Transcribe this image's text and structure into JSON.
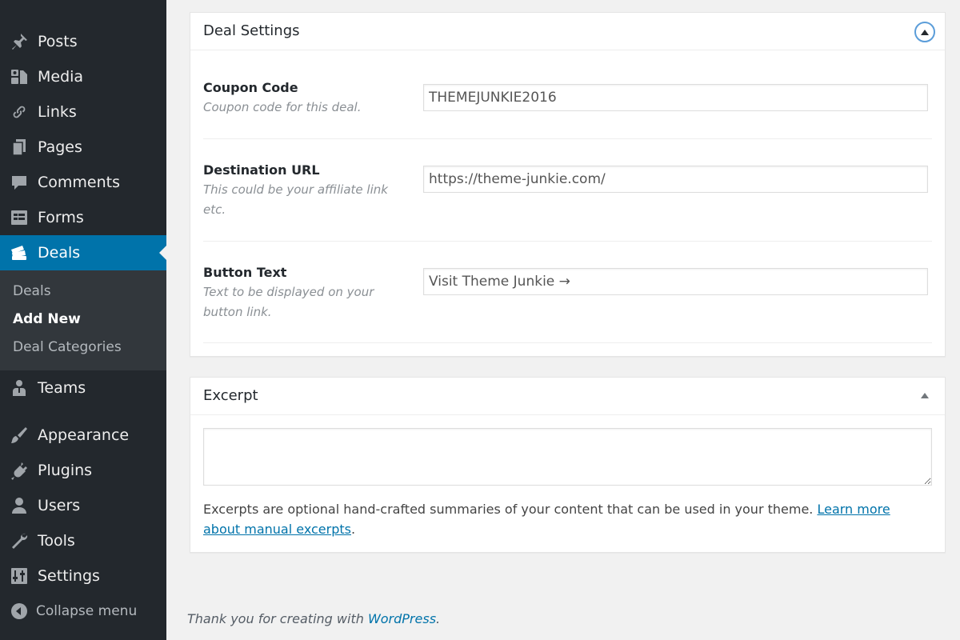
{
  "sidebar": {
    "items": [
      {
        "label": "Posts",
        "icon": "pin-icon"
      },
      {
        "label": "Media",
        "icon": "media-icon"
      },
      {
        "label": "Links",
        "icon": "link-icon"
      },
      {
        "label": "Pages",
        "icon": "pages-icon"
      },
      {
        "label": "Comments",
        "icon": "comment-icon"
      },
      {
        "label": "Forms",
        "icon": "forms-icon"
      },
      {
        "label": "Deals",
        "icon": "deals-icon",
        "current": true
      },
      {
        "label": "Teams",
        "icon": "teams-icon"
      },
      {
        "label": "Appearance",
        "icon": "brush-icon"
      },
      {
        "label": "Plugins",
        "icon": "plug-icon"
      },
      {
        "label": "Users",
        "icon": "user-icon"
      },
      {
        "label": "Tools",
        "icon": "wrench-icon"
      },
      {
        "label": "Settings",
        "icon": "settings-icon"
      }
    ],
    "submenu": [
      {
        "label": "Deals"
      },
      {
        "label": "Add New",
        "active": true
      },
      {
        "label": "Deal Categories"
      }
    ],
    "collapse_label": "Collapse menu",
    "accent_color": "#0073aa",
    "background_color": "#23282d"
  },
  "deal_settings": {
    "title": "Deal Settings",
    "fields": [
      {
        "label": "Coupon Code",
        "description": "Coupon code for this deal.",
        "value": "THEMEJUNKIE2016"
      },
      {
        "label": "Destination URL",
        "description": "This could be your affiliate link etc.",
        "value": "https://theme-junkie.com/"
      },
      {
        "label": "Button Text",
        "description": "Text to be displayed on your button link.",
        "value": "Visit Theme Junkie →"
      }
    ]
  },
  "excerpt": {
    "title": "Excerpt",
    "value": "",
    "help_text": "Excerpts are optional hand-crafted summaries of your content that can be used in your theme. ",
    "help_link": "Learn more about manual excerpts",
    "help_end": "."
  },
  "footer": {
    "text": "Thank you for creating with ",
    "link": "WordPress",
    "end": "."
  }
}
